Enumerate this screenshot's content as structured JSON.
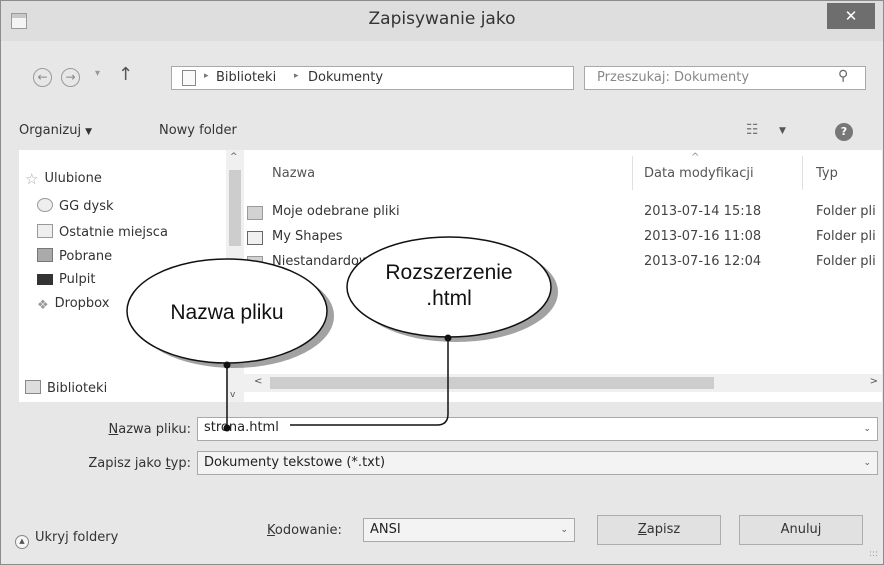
{
  "window": {
    "title": "Zapisywanie jako",
    "close_glyph": "✕"
  },
  "address_bar": {
    "back_glyph": "←",
    "forward_glyph": "→",
    "recent_glyph": "▾",
    "up_glyph": "↑",
    "crumbs": [
      "Biblioteki",
      "Dokumenty"
    ],
    "crumb_sep": "▸",
    "dropdown_glyph": "⌄",
    "refresh_glyph": "↻",
    "search_placeholder": "Przeszukaj: Dokumenty",
    "search_glyph": "⚲"
  },
  "toolbar": {
    "organize_label": "Organizuj",
    "organize_caret": "▼",
    "new_folder_label": "Nowy folder",
    "views_glyph": "☷",
    "views_caret": "▼",
    "help_glyph": "?"
  },
  "nav_pane": {
    "items": [
      {
        "label": "Ulubione",
        "icon": "star-icon"
      },
      {
        "label": "GG dysk",
        "icon": "gg-disk-icon"
      },
      {
        "label": "Ostatnie miejsca",
        "icon": "recent-places-icon"
      },
      {
        "label": "Pobrane",
        "icon": "downloads-icon"
      },
      {
        "label": "Pulpit",
        "icon": "desktop-icon"
      },
      {
        "label": "Dropbox",
        "icon": "dropbox-icon"
      },
      {
        "label": "Biblioteki",
        "icon": "libraries-icon"
      }
    ],
    "up_glyph": "^",
    "down_glyph": "v"
  },
  "file_list": {
    "columns": [
      "Nazwa",
      "Data modyfikacji",
      "Typ"
    ],
    "rows": [
      {
        "name": "Moje odebrane pliki",
        "date": "2013-07-14 15:18",
        "type": "Folder pli",
        "icon": "folder-icon"
      },
      {
        "name": "My Shapes",
        "date": "2013-07-16 11:08",
        "type": "Folder pli",
        "icon": "shapes-folder-icon"
      },
      {
        "name": "Niestandardowe szablony pakietu Office",
        "date": "2013-07-16 12:04",
        "type": "Folder pli",
        "icon": "folder-icon"
      }
    ],
    "scroll_left": "<",
    "scroll_right": ">"
  },
  "form": {
    "filename_label_u": "N",
    "filename_label_rest": "azwa pliku:",
    "filename_value": "strona.html",
    "type_label_pre": "Zapisz jako ",
    "type_label_u": "t",
    "type_label_post": "yp:",
    "type_value": "Dokumenty tekstowe (*.txt)",
    "combo_caret": "⌄"
  },
  "footer": {
    "hide_label": "Ukryj foldery",
    "hide_glyph": "▲",
    "encoding_label_u": "K",
    "encoding_label_rest": "odowanie:",
    "encoding_value": "ANSI",
    "save_u": "Z",
    "save_rest": "apisz",
    "cancel_label": "Anuluj",
    "grip": ":::"
  },
  "callouts": {
    "filename_text": "Nazwa pliku",
    "extension_line1": "Rozszerzenie",
    "extension_line2": ".html"
  }
}
